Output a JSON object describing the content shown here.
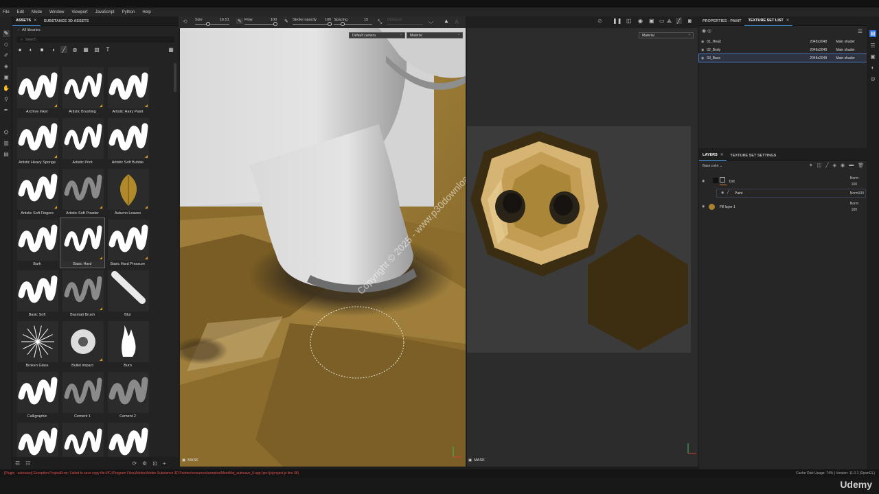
{
  "menu": [
    "File",
    "Edit",
    "Mode",
    "Window",
    "Viewport",
    "JavaScript",
    "Python",
    "Help"
  ],
  "assets_panel": {
    "tabs": [
      {
        "label": "ASSETS"
      },
      {
        "label": "SUBSTANCE 3D ASSETS"
      }
    ],
    "library": "All libraries",
    "search_placeholder": "Search",
    "brushes": [
      "Archive Inker",
      "Artistic Brushing",
      "Artistic Hairy Paint",
      "Artistic Heavy Sponge",
      "Artistic Print",
      "Artistic Soft Bubble",
      "Artistic Soft Fingers",
      "Artistic Soft Powder",
      "Autumn Leaves",
      "Bark",
      "Basic Hard",
      "Basic Hard Pressure",
      "Basic Soft",
      "Basmati Brush",
      "Blur",
      "Broken Glass",
      "Bullet Impact",
      "Burn",
      "Calligraphic",
      "Cement 1",
      "Cement 2",
      "",
      "",
      ""
    ],
    "selected": "Basic Hard"
  },
  "toolbar": {
    "size_label": "Size",
    "size_value": "16.51",
    "flow_label": "Flow",
    "flow_value": "100",
    "opacity_label": "Stroke opacity",
    "opacity_value": "100",
    "spacing_label": "Spacing",
    "spacing_value": "15",
    "distance_label": "Distance"
  },
  "viewport": {
    "camera": "Default camera",
    "mode_3d": "Material",
    "mode_2d": "Material",
    "mask_label": "MASK",
    "watermark": "Copyright © 2025 - www.p30download.com"
  },
  "texture_sets": {
    "tabs": [
      {
        "label": "PROPERTIES - PAINT"
      },
      {
        "label": "TEXTURE SET LIST"
      }
    ],
    "items": [
      {
        "name": "01_Head",
        "res": "2048x2048",
        "shader": "Main shader"
      },
      {
        "name": "02_Body",
        "res": "2048x2048",
        "shader": "Main shader"
      },
      {
        "name": "03_Base",
        "res": "2048x2048",
        "shader": "Main shader"
      }
    ]
  },
  "layers_panel": {
    "tabs": [
      {
        "label": "LAYERS"
      },
      {
        "label": "TEXTURE SET SETTINGS"
      }
    ],
    "channel": "Base color",
    "layers": [
      {
        "name": "Dirt",
        "blend": "Norm",
        "opacity": "100"
      },
      {
        "name": "Paint",
        "blend": "Norm",
        "opacity": "100"
      },
      {
        "name": "Fill layer 1",
        "blend": "Norm",
        "opacity": "100"
      }
    ]
  },
  "status": {
    "error": "[Plugin - autosave] Exception ProjectError: Failed to save copy file:///C:/Program Files/Adobe/Adobe Substance 3D Painter/resources/samples/MeetMat_autosave_0.spp (qrc:/js/project.js line 38)",
    "right": "Cache Disk Usage:   74%  |  Version: 11.0.1 (OpenGL)"
  },
  "branding": "Udemy"
}
